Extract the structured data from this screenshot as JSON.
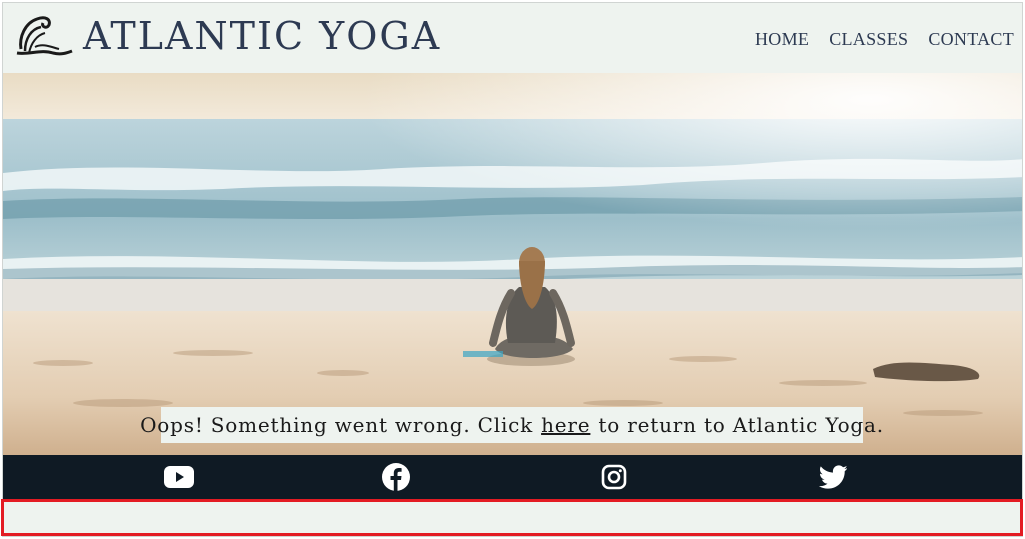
{
  "header": {
    "brand": "ATLANTIC YOGA",
    "logo_icon": "wave-icon",
    "nav": [
      {
        "label": "HOME"
      },
      {
        "label": "CLASSES"
      },
      {
        "label": "CONTACT"
      }
    ]
  },
  "hero": {
    "image": "woman-meditating-on-beach",
    "message": {
      "before": "Oops! Something went wrong. Click",
      "link": "here",
      "after": "to return to Atlantic Yoga."
    }
  },
  "footer": {
    "social": [
      {
        "icon": "youtube-icon"
      },
      {
        "icon": "facebook-icon"
      },
      {
        "icon": "instagram-icon"
      },
      {
        "icon": "twitter-icon"
      }
    ]
  },
  "colors": {
    "header_bg": "#eef3ef",
    "brand_text": "#2d3a52",
    "footer_bg": "#0f1a24",
    "highlight": "#e31b23"
  }
}
